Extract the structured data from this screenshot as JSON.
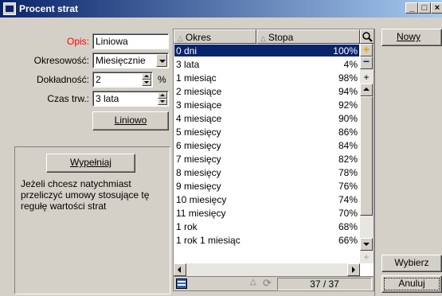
{
  "window": {
    "title": "Procent strat"
  },
  "form": {
    "opis_label": "Opis:",
    "opis_value": "Liniowa",
    "okresowosc_label": "Okresowość:",
    "okresowosc_value": "Miesięcznie",
    "dokladnosc_label": "Dokładność:",
    "dokladnosc_value": "2",
    "dokladnosc_unit": "%",
    "czas_label": "Czas trw.:",
    "czas_value": "3 lata",
    "liniowo_label": "Liniowo"
  },
  "fill_panel": {
    "button_label": "Wypełniaj",
    "description": "Jeżeli chcesz natychmiast przeliczyć umowy stosujące tę regułę wartości strat"
  },
  "grid": {
    "columns": [
      "Okres",
      "Stopa"
    ],
    "rows": [
      {
        "okres": "0 dni",
        "stopa": "100%"
      },
      {
        "okres": "3 lata",
        "stopa": "4%"
      },
      {
        "okres": "1 miesiąc",
        "stopa": "98%"
      },
      {
        "okres": "2 miesiące",
        "stopa": "94%"
      },
      {
        "okres": "3 miesiące",
        "stopa": "92%"
      },
      {
        "okres": "4 miesiące",
        "stopa": "90%"
      },
      {
        "okres": "5 miesięcy",
        "stopa": "86%"
      },
      {
        "okres": "6 miesięcy",
        "stopa": "84%"
      },
      {
        "okres": "7 miesięcy",
        "stopa": "82%"
      },
      {
        "okres": "8 miesięcy",
        "stopa": "78%"
      },
      {
        "okres": "9 miesięcy",
        "stopa": "76%"
      },
      {
        "okres": "10 miesięcy",
        "stopa": "74%"
      },
      {
        "okres": "11 miesięcy",
        "stopa": "70%"
      },
      {
        "okres": "1 rok",
        "stopa": "68%"
      },
      {
        "okres": "1 rok 1 miesiąc",
        "stopa": "66%"
      }
    ],
    "record_counter": "37 / 37"
  },
  "right_panel": {
    "nowy_label": "Nowy",
    "wybierz_label": "Wybierz",
    "anuluj_label": "Anuluj"
  }
}
